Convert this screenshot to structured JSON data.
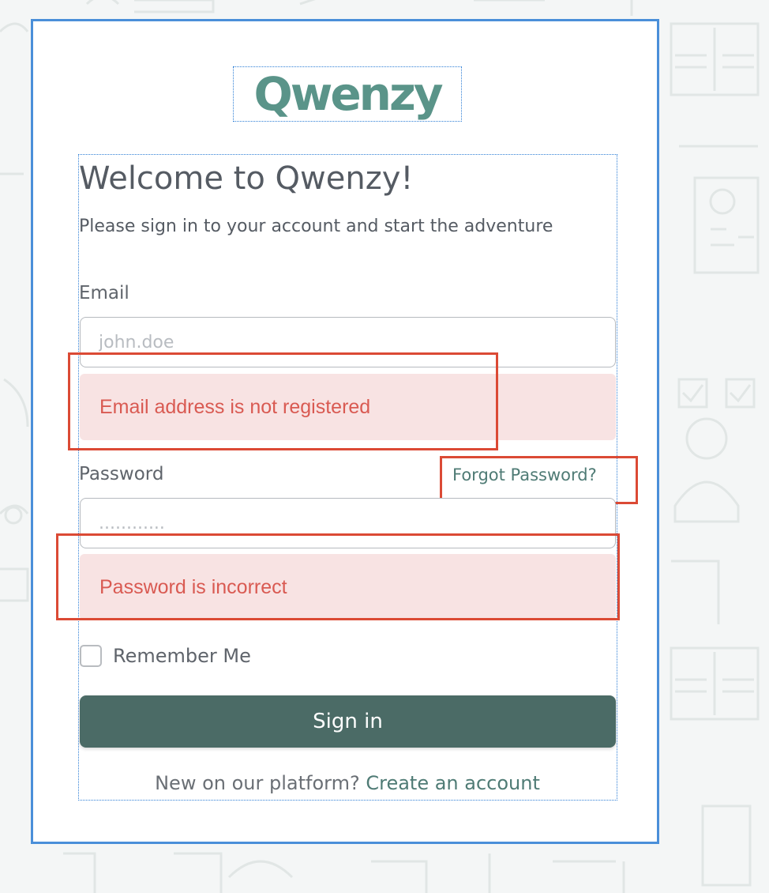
{
  "brand": {
    "logo_text": "Qwenzy",
    "color": "#5a9489"
  },
  "header": {
    "title": "Welcome to Qwenzy!",
    "subtitle": "Please sign in to your account and start the adventure"
  },
  "form": {
    "email": {
      "label": "Email",
      "placeholder": "john.doe",
      "value": "",
      "error": "Email address is not registered"
    },
    "password": {
      "label": "Password",
      "placeholder": "............",
      "value": "",
      "error": "Password is incorrect",
      "forgot_link": "Forgot Password?"
    },
    "remember": {
      "label": "Remember Me",
      "checked": false
    },
    "submit_label": "Sign in"
  },
  "footer": {
    "prompt": "New on our platform?",
    "link": "Create an account"
  },
  "colors": {
    "primary_button": "#4b6b66",
    "link": "#4f7b75",
    "error_text": "#d95a52",
    "error_background": "#f8e3e3",
    "highlight": "#db4a35",
    "card_border": "#4a8fd9"
  }
}
